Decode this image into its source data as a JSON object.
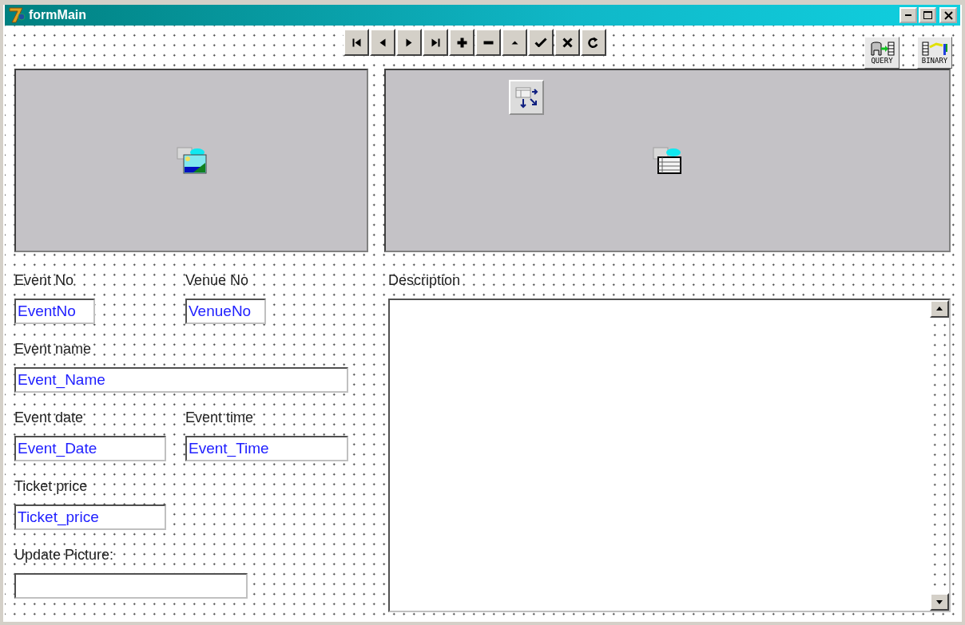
{
  "window": {
    "title": "formMain"
  },
  "navigator": {
    "buttons": [
      {
        "kind": "first"
      },
      {
        "kind": "prior"
      },
      {
        "kind": "next"
      },
      {
        "kind": "last"
      },
      {
        "kind": "insert"
      },
      {
        "kind": "delete"
      },
      {
        "kind": "edit"
      },
      {
        "kind": "post"
      },
      {
        "kind": "cancel"
      },
      {
        "kind": "refresh"
      }
    ]
  },
  "components": [
    {
      "kind": "query",
      "label": "QUERY"
    },
    {
      "kind": "binary",
      "label": "BINARY"
    }
  ],
  "panels": [
    {
      "kind": "image"
    },
    {
      "kind": "grid"
    }
  ],
  "field_rows": [
    [
      {
        "label": "Event No",
        "value": "EventNo"
      },
      {
        "label": "Venue No",
        "value": "VenueNo"
      }
    ],
    [
      {
        "label": "Event name",
        "value": "Event_Name"
      }
    ],
    [
      {
        "label": "Event date",
        "value": "Event_Date"
      },
      {
        "label": "Event time",
        "value": "Event_Time"
      }
    ],
    [
      {
        "label": "Ticket price",
        "value": "Ticket_price"
      }
    ],
    [
      {
        "label": "Update Picture:"
      }
    ]
  ],
  "description": {
    "label": "Description"
  }
}
